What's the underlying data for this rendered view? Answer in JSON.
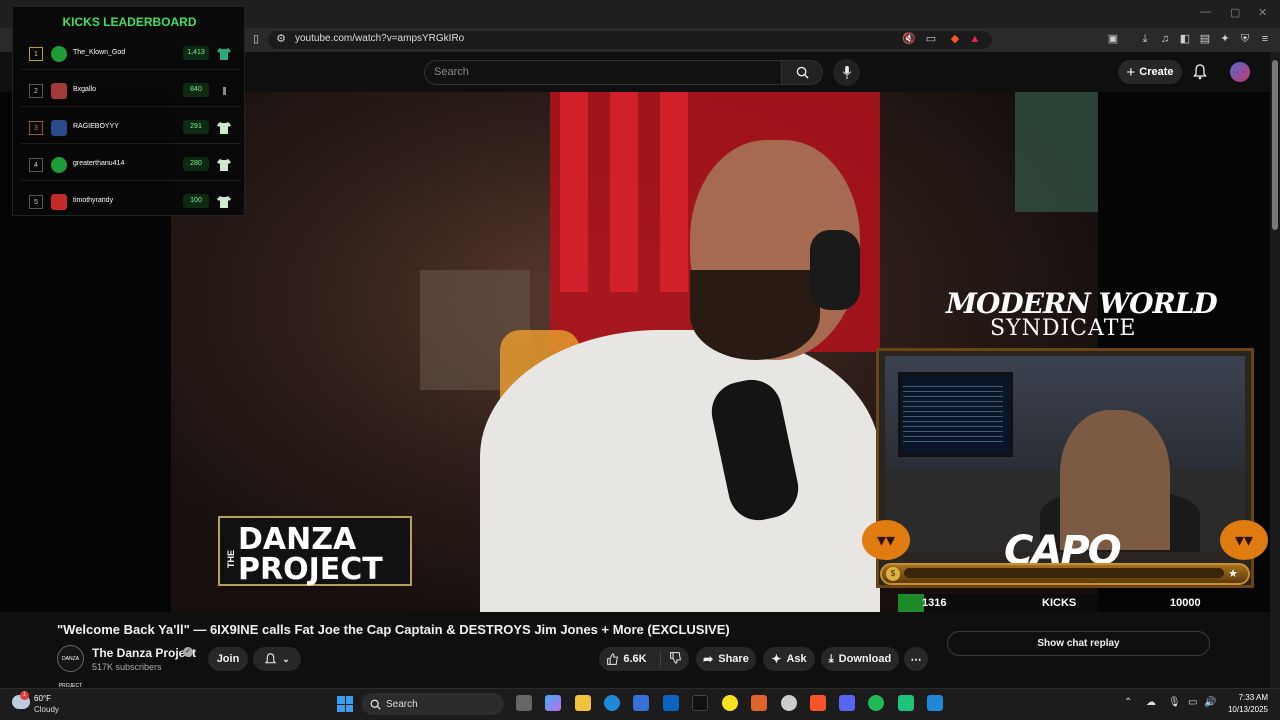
{
  "browser": {
    "url": "youtube.com/watch?v=ampsYRGkIRo"
  },
  "youtube": {
    "search_placeholder": "Search",
    "create_label": "Create"
  },
  "leaderboard": {
    "title": "KICKS LEADERBOARD",
    "entries": [
      {
        "rank": "1",
        "name": "The_Klown_God",
        "score": "1,413"
      },
      {
        "rank": "2",
        "name": "Bxgallo",
        "score": "840"
      },
      {
        "rank": "3",
        "name": "RAGIEBOYYY",
        "score": "291"
      },
      {
        "rank": "4",
        "name": "greaterthanu414",
        "score": "280"
      },
      {
        "rank": "5",
        "name": "timothyrandy",
        "score": "100"
      }
    ]
  },
  "overlay": {
    "danza_the": "THE",
    "danza_line1": "DANZA",
    "danza_line2": "PROJECT",
    "mws_line1": "MODERN WORLD",
    "mws_line2": "SYNDICATE",
    "streamer_name": "CAPO",
    "kicks_current": "1316",
    "kicks_label": "KICKS",
    "kicks_goal": "10000",
    "kicks_progress": 0.1316
  },
  "video": {
    "title": "\"Welcome Back Ya'll\" — 6IX9INE calls Fat Joe the Cap Captain & DESTROYS Jim Jones + More (EXCLUSIVE)",
    "channel_name": "The Danza Project",
    "channel_avatar_text": "DANZA PROJECT",
    "subscribers": "517K subscribers",
    "join_label": "Join",
    "like_count": "6.6K",
    "share_label": "Share",
    "ask_label": "Ask",
    "download_label": "Download",
    "chat_replay_label": "Show chat replay"
  },
  "taskbar": {
    "temperature": "60°F",
    "condition": "Cloudy",
    "weather_badge": "1",
    "search_label": "Search",
    "time": "7:33 AM",
    "date": "10/13/2025"
  }
}
